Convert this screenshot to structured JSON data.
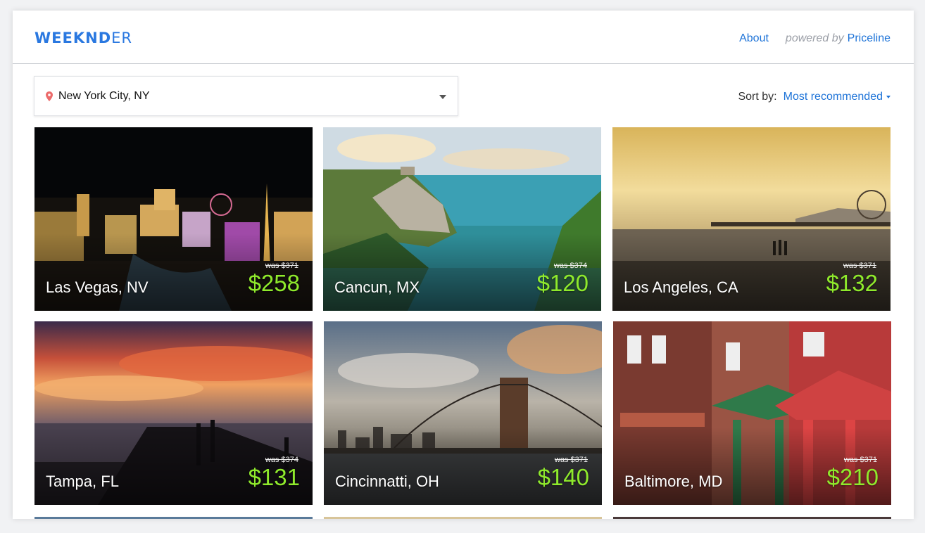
{
  "header": {
    "logo_part1": "WEEKND",
    "logo_part2": "ER",
    "about_label": "About",
    "powered_by": "powered by",
    "partner": "Priceline"
  },
  "location": {
    "icon": "map-pin-icon",
    "value": "New York City, NY"
  },
  "sort": {
    "label": "Sort by:",
    "value": "Most recommended"
  },
  "colors": {
    "brand": "#2a78e0",
    "link": "#1f74d8",
    "price": "#8fea2c"
  },
  "destinations": [
    {
      "city": "Las Vegas, NV",
      "was": "was $371",
      "price": "$258"
    },
    {
      "city": "Cancun, MX",
      "was": "was $374",
      "price": "$120"
    },
    {
      "city": "Los Angeles, CA",
      "was": "was $371",
      "price": "$132"
    },
    {
      "city": "Tampa, FL",
      "was": "was $374",
      "price": "$131"
    },
    {
      "city": "Cincinnatti, OH",
      "was": "was $371",
      "price": "$140"
    },
    {
      "city": "Baltimore, MD",
      "was": "was $371",
      "price": "$210"
    }
  ]
}
